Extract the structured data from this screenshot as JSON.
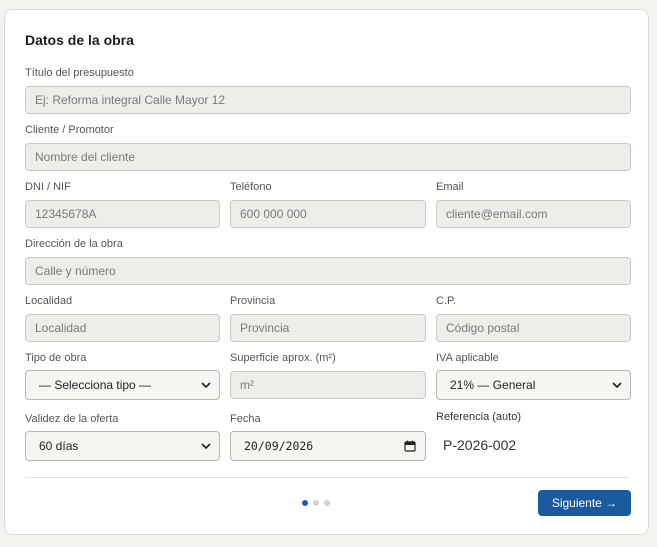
{
  "form": {
    "title": "Datos de la obra",
    "budget_title": {
      "label": "Título del presupuesto",
      "placeholder": "Ej: Reforma integral Calle Mayor 12"
    },
    "client": {
      "label": "Cliente / Promotor",
      "placeholder": "Nombre del cliente"
    },
    "dni": {
      "label": "DNI / NIF",
      "placeholder": "12345678A"
    },
    "phone": {
      "label": "Teléfono",
      "placeholder": "600 000 000"
    },
    "email": {
      "label": "Email",
      "placeholder": "cliente@email.com"
    },
    "address": {
      "label": "Dirección de la obra",
      "placeholder": "Calle y número"
    },
    "city": {
      "label": "Localidad",
      "placeholder": "Localidad"
    },
    "province": {
      "label": "Provincia",
      "placeholder": "Provincia"
    },
    "postal_code": {
      "label": "C.P.",
      "placeholder": "Código postal"
    },
    "work_type": {
      "label": "Tipo de obra",
      "value": "— Selecciona tipo —"
    },
    "surface": {
      "label": "Superficie aprox. (m²)",
      "placeholder": "m²"
    },
    "vat": {
      "label": "IVA aplicable",
      "value": "21% — General"
    },
    "validity": {
      "label": "Validez de la oferta",
      "value": "60 días"
    },
    "date": {
      "label": "Fecha",
      "value": "20/09/2026"
    },
    "reference": {
      "label": "Referencia (auto)",
      "value": "P-2026-002"
    }
  },
  "pager": {
    "total_steps": 3,
    "current_step": 1
  },
  "next_button": "Siguiente →",
  "icons": {
    "select": "chevron-down-icon",
    "date": "calendar-icon"
  },
  "colors": {
    "primary": "#1c5a9e",
    "field_bg": "#efedea",
    "page_bg": "#f3f2ee"
  }
}
